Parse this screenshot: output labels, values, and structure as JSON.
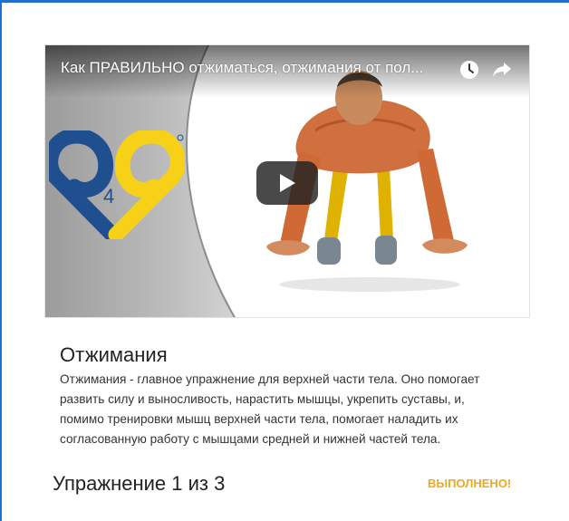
{
  "video": {
    "title": "Как ПРАВИЛЬНО отжиматься, отжимания от пол...",
    "logo_text": "4",
    "colors": {
      "logo_blue": "#1f4f8f",
      "logo_yellow": "#f7d117"
    }
  },
  "exercise": {
    "name": "Отжимания",
    "description": "Отжимания - главное упражнение для верхней части тела. Оно помогает развить силу и выносливость, нарастить мышцы, укрепить суставы, и, помимо тренировки мышц верхней части тела, помогает наладить их согласованную работу с мышцами средней и нижней частей тела."
  },
  "footer": {
    "progress_label": "Упражнение 1 из 3",
    "status_label": "ВЫПОЛНЕНО!",
    "colors": {
      "status": "#f0a81c"
    }
  },
  "icons": {
    "watch_later": "clock-icon",
    "share": "share-icon",
    "play": "play-icon"
  }
}
